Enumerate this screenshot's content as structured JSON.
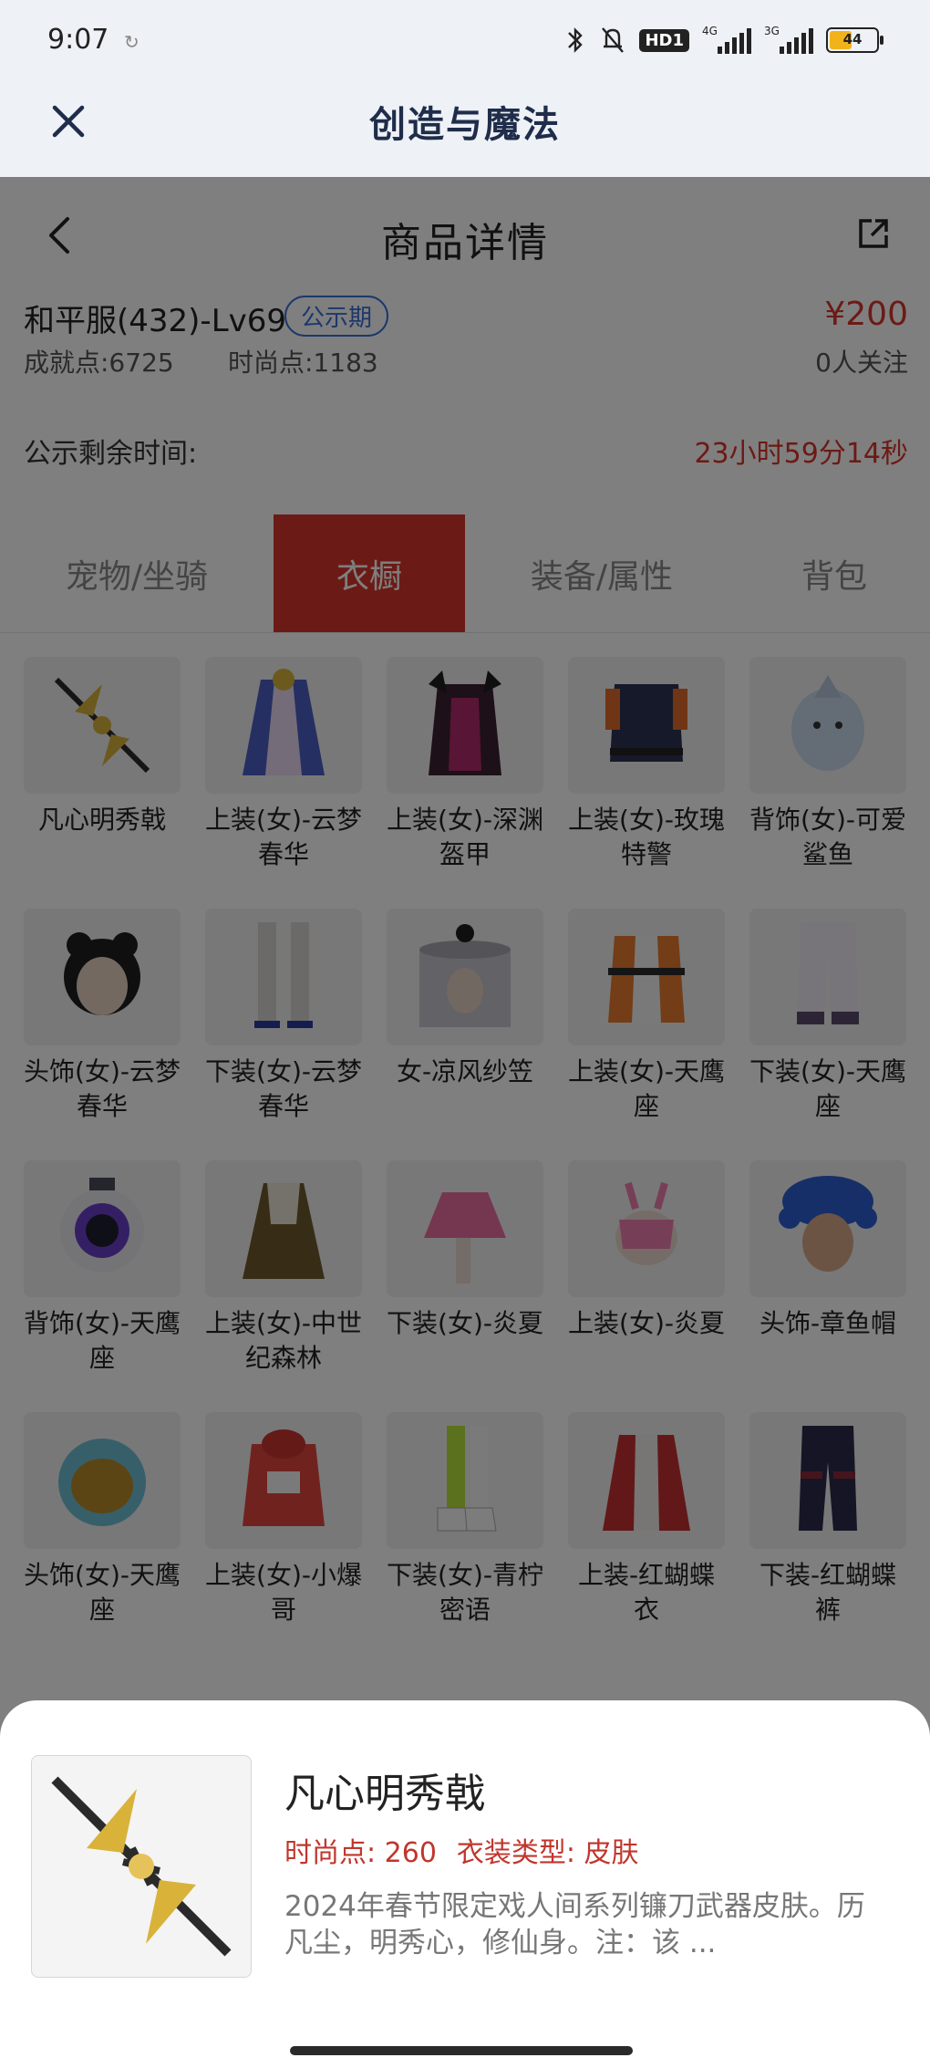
{
  "status_bar": {
    "time": "9:07",
    "network_1": "4G",
    "network_2": "3G",
    "hd_label": "HD1",
    "battery_level": "44"
  },
  "app_bar": {
    "title": "创造与魔法"
  },
  "detail": {
    "page_title": "商品详情",
    "character_name": "和平服(432)-Lv69",
    "status_badge": "公示期",
    "price": "¥200",
    "achievement_points": "成就点:6725",
    "fashion_points": "时尚点:1183",
    "followers": "0人关注",
    "countdown_label": "公示剩余时间:",
    "countdown_value": "23小时59分14秒"
  },
  "tabs": [
    {
      "label": "宠物/坐骑",
      "active": false
    },
    {
      "label": "衣橱",
      "active": true
    },
    {
      "label": "装备/属性",
      "active": false
    },
    {
      "label": "背包",
      "active": false
    }
  ],
  "wardrobe_items": [
    {
      "name": "凡心明秀戟",
      "icon": "halberd"
    },
    {
      "name": "上装(女)-云梦春华",
      "icon": "robe-blue"
    },
    {
      "name": "上装(女)-深渊盔甲",
      "icon": "armor-dark"
    },
    {
      "name": "上装(女)-玫瑰特警",
      "icon": "uniform-navy"
    },
    {
      "name": "背饰(女)-可爱鲨鱼",
      "icon": "shark"
    },
    {
      "name": "头饰(女)-云梦春华",
      "icon": "head-girl"
    },
    {
      "name": "下装(女)-云梦春华",
      "icon": "legs-white"
    },
    {
      "name": "女-凉风纱笠",
      "icon": "veil-hat"
    },
    {
      "name": "上装(女)-天鹰座",
      "icon": "jacket-orange"
    },
    {
      "name": "下装(女)-天鹰座",
      "icon": "pants-white"
    },
    {
      "name": "背饰(女)-天鹰座",
      "icon": "backpack-tech"
    },
    {
      "name": "上装(女)-中世纪森林",
      "icon": "dress-forest"
    },
    {
      "name": "下装(女)-炎夏",
      "icon": "skirt-pink"
    },
    {
      "name": "上装(女)-炎夏",
      "icon": "top-pink"
    },
    {
      "name": "头饰-章鱼帽",
      "icon": "octopus-hat"
    },
    {
      "name": "头饰(女)-天鹰座",
      "icon": "helmet-gold"
    },
    {
      "name": "上装(女)-小爆哥",
      "icon": "hoodie-red"
    },
    {
      "name": "下装(女)-青柠密语",
      "icon": "boots-lime"
    },
    {
      "name": "上装-红蝴蝶衣",
      "icon": "coat-red"
    },
    {
      "name": "下装-红蝴蝶裤",
      "icon": "pants-dark"
    }
  ],
  "bottom_sheet": {
    "item_name": "凡心明秀戟",
    "fashion_points": "时尚点: 260",
    "type": "衣装类型: 皮肤",
    "description": "2024年春节限定戏人间系列镰刀武器皮肤。历凡尘，明秀心，修仙身。注：该 ..."
  },
  "colors": {
    "accent_red": "#d9342b",
    "badge_blue": "#3a6fd8",
    "header_bg": "#eef1f6"
  }
}
